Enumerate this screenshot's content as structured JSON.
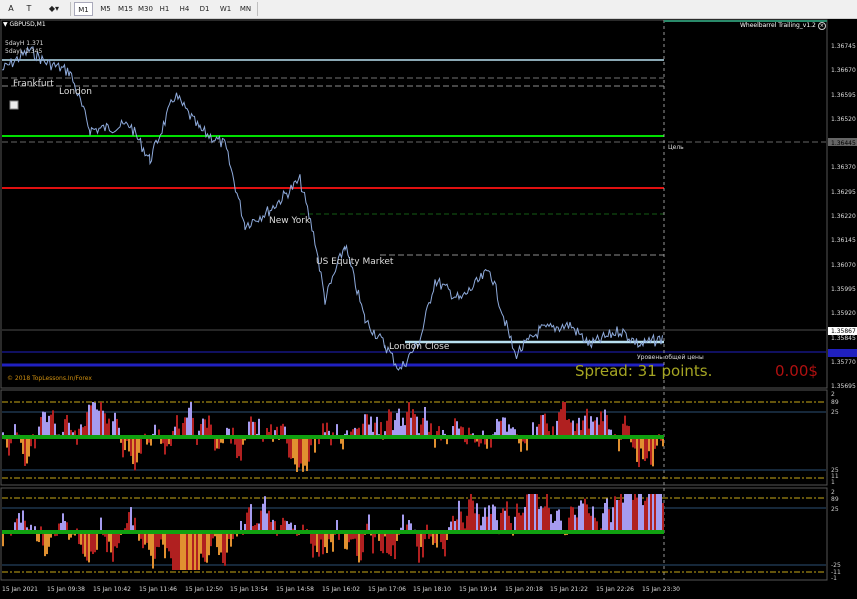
{
  "toolbar": {
    "tools": [
      "A",
      "T",
      "◆▾"
    ],
    "timeframes": [
      "M1",
      "M5",
      "M15",
      "M30",
      "H1",
      "H4",
      "D1",
      "W1",
      "MN"
    ],
    "active_timeframe": "M1"
  },
  "chart": {
    "symbol_label": "GBPUSD,M1",
    "indicator_name": "Wheelbarrel Trailing_v1.2",
    "high_label": "5dayH 1.371",
    "low_label": "5dayL 1.345",
    "copyright": "© 2018 TopLessons.In/Forex",
    "target_label": "Цель",
    "total_price_label": "Уровень общей цены",
    "spread_label": "Spread: 31 points.",
    "profit_label": "0.00$",
    "sessions": [
      "Frankfurt",
      "London",
      "New York",
      "US Equity Market",
      "London Close"
    ],
    "price_axis": [
      "1.36745",
      "1.36670",
      "1.36595",
      "1.36520",
      "1.36445",
      "1.36370",
      "1.36295",
      "1.36220",
      "1.36145",
      "1.36070",
      "1.35995",
      "1.35920",
      "1.35845",
      "1.35770",
      "1.35695"
    ],
    "current_price": "1.35867",
    "time_axis": [
      "15 Jan 2021",
      "15 Jan 09:38",
      "15 Jan 10:42",
      "15 Jan 11:46",
      "15 Jan 12:50",
      "15 Jan 13:54",
      "15 Jan 14:58",
      "15 Jan 16:02",
      "15 Jan 17:06",
      "15 Jan 18:10",
      "15 Jan 19:14",
      "15 Jan 20:18",
      "15 Jan 21:22",
      "15 Jan 22:26",
      "15 Jan 23:30"
    ],
    "indicator1_axis": [
      "2",
      "89",
      "25",
      "25",
      "11",
      "1"
    ],
    "indicator2_axis": [
      "2",
      "89",
      "25",
      "-25",
      "-11",
      "-1"
    ],
    "colors": {
      "background": "#000000",
      "candle_line": "#8eaadb",
      "target_line": "#00e000",
      "stop_line": "#e01010",
      "entry_line": "#b8e0f0",
      "blue_level": "#2020c0",
      "spread_text": "#a5a523",
      "profit_text": "#b01010",
      "hist_purple": "#a69cf0",
      "hist_orange": "#e09030",
      "hist_red": "#b02020",
      "hist_green": "#10a010"
    }
  }
}
